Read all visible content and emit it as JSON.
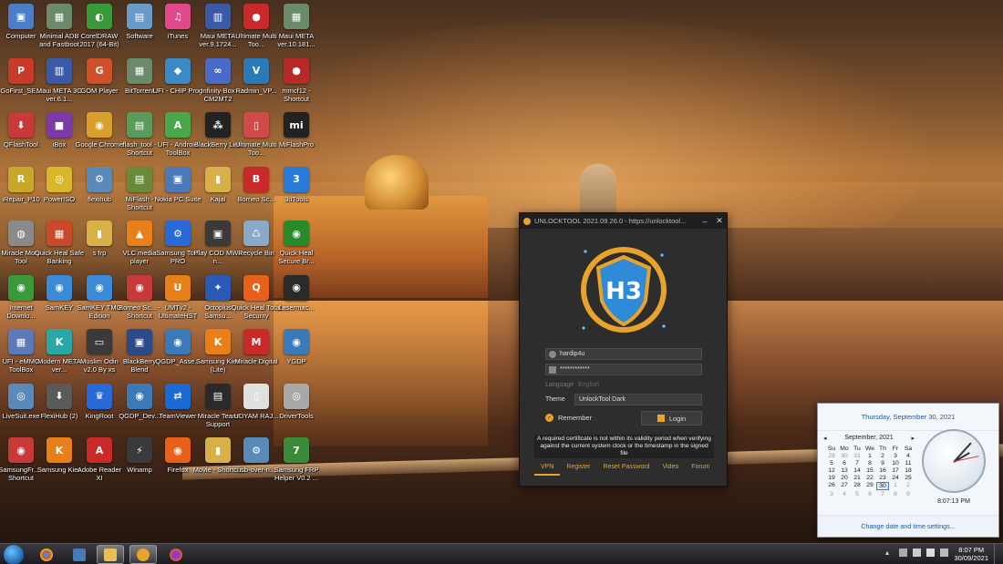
{
  "desktop_icons": [
    {
      "label": "Computer",
      "glyph": "▣",
      "color": "#4a7fc8"
    },
    {
      "label": "Minimal ADB and Fastboot",
      "glyph": "▦",
      "color": "#6a8a6a"
    },
    {
      "label": "CorelDRAW 2017 (64-Bit)",
      "glyph": "◐",
      "color": "#3a9a3a"
    },
    {
      "label": "Software",
      "glyph": "▤",
      "color": "#6a9ac8"
    },
    {
      "label": "iTunes",
      "glyph": "♫",
      "color": "#e04a8a"
    },
    {
      "label": "Maui META ver.9.1724...",
      "glyph": "▥",
      "color": "#3a5aa8"
    },
    {
      "label": "Ultimate Multi Too...",
      "glyph": "●",
      "color": "#c82a2a"
    },
    {
      "label": "Maui META ver.10.181...",
      "glyph": "▦",
      "color": "#6a8a6a"
    },
    {
      "label": "GoFirst_SE...",
      "glyph": "P",
      "color": "#c83a2a"
    },
    {
      "label": "Maui META 3G ver.6.1...",
      "glyph": "▥",
      "color": "#3a5aa8"
    },
    {
      "label": "GOM Player",
      "glyph": "G",
      "color": "#d0502a"
    },
    {
      "label": "BitTorrent",
      "glyph": "▦",
      "color": "#6a8a6a"
    },
    {
      "label": "UFI - CHIP Prog",
      "glyph": "◆",
      "color": "#3a8ac8"
    },
    {
      "label": "Infinity-Box CM2MT2",
      "glyph": "∞",
      "color": "#4a6ac8"
    },
    {
      "label": "Radmin_VP...",
      "glyph": "V",
      "color": "#2a7ab8"
    },
    {
      "label": "mmcf12 - Shortcut",
      "glyph": "●",
      "color": "#b82a2a"
    },
    {
      "label": "QFlashTool",
      "glyph": "⬇",
      "color": "#c83a3a"
    },
    {
      "label": "iBox",
      "glyph": "■",
      "color": "#7a3aa8"
    },
    {
      "label": "Google Chrome",
      "glyph": "◉",
      "color": "#d8a02a"
    },
    {
      "label": "flash_tool - Shortcut",
      "glyph": "▤",
      "color": "#5a9a5a"
    },
    {
      "label": "UFI - Android ToolBox",
      "glyph": "A",
      "color": "#4aa84a"
    },
    {
      "label": "BlackBerry Link",
      "glyph": "⁂",
      "color": "#222222"
    },
    {
      "label": "Ultimate Multi Too...",
      "glyph": "▯",
      "color": "#d04a4a"
    },
    {
      "label": "MiFlashPro",
      "glyph": "mi",
      "color": "#222222"
    },
    {
      "label": "iRepair_P10",
      "glyph": "R",
      "color": "#c8a82a"
    },
    {
      "label": "PowerISO",
      "glyph": "◎",
      "color": "#d8b82a"
    },
    {
      "label": "flexihub",
      "glyph": "⚙",
      "color": "#5a8ab8"
    },
    {
      "label": "MiFlash - Shortcut",
      "glyph": "▤",
      "color": "#6a8a3a"
    },
    {
      "label": "Nokia PC Suite",
      "glyph": "▣",
      "color": "#4a7ab8"
    },
    {
      "label": "Kajal",
      "glyph": "▮",
      "color": "#d8b04a"
    },
    {
      "label": "Borneo Sc...",
      "glyph": "B",
      "color": "#c82a2a"
    },
    {
      "label": "3uTools",
      "glyph": "3",
      "color": "#2a7ad8"
    },
    {
      "label": "Miracle Moto Tool",
      "glyph": "◍",
      "color": "#8a8a8a"
    },
    {
      "label": "Quick Heal Safe Banking",
      "glyph": "▦",
      "color": "#c84a2a"
    },
    {
      "label": "s frp",
      "glyph": "▮",
      "color": "#d8b04a"
    },
    {
      "label": "VLC media player",
      "glyph": "▲",
      "color": "#e8801a"
    },
    {
      "label": "Samsung Tool PRO",
      "glyph": "⚙",
      "color": "#2a6ad8"
    },
    {
      "label": "Play COD MW3 n...",
      "glyph": "▣",
      "color": "#3a3a3a"
    },
    {
      "label": "Recycle Bin",
      "glyph": "♺",
      "color": "#8aa8c8"
    },
    {
      "label": "Quick Heal Secure Br...",
      "glyph": "◉",
      "color": "#2a8a2a"
    },
    {
      "label": "Internet Downlo...",
      "glyph": "◉",
      "color": "#3a9a3a"
    },
    {
      "label": "SamKEY",
      "glyph": "◉",
      "color": "#3a8ad8"
    },
    {
      "label": "SamKEY TMO Edition",
      "glyph": "◉",
      "color": "#3a8ad8"
    },
    {
      "label": "Borneo Sc... - Shortcut",
      "glyph": "◉",
      "color": "#c83a3a"
    },
    {
      "label": "UMTv2 - UltimateHST",
      "glyph": "U",
      "color": "#e8801a"
    },
    {
      "label": "Octoplus Samsu...",
      "glyph": "✦",
      "color": "#2a5ab8"
    },
    {
      "label": "Quick Heal Total Security",
      "glyph": "Q",
      "color": "#e8601a"
    },
    {
      "label": "Lasermac...",
      "glyph": "◉",
      "color": "#2a2a2a"
    },
    {
      "label": "UFI - eMMC ToolBox",
      "glyph": "▦",
      "color": "#5a7ab8"
    },
    {
      "label": "Modern META ver...",
      "glyph": "K",
      "color": "#2aa8a8"
    },
    {
      "label": "Muslim Odin v2.0 By xs",
      "glyph": "▭",
      "color": "#3a3a3a"
    },
    {
      "label": "BlackBerry Blend",
      "glyph": "▣",
      "color": "#2a4a8a"
    },
    {
      "label": "QGDP_Asse...",
      "glyph": "◉",
      "color": "#3a7ab8"
    },
    {
      "label": "Samsung Kies (Lite)",
      "glyph": "K",
      "color": "#e8801a"
    },
    {
      "label": "Miracle Digital",
      "glyph": "M",
      "color": "#c82a2a"
    },
    {
      "label": "YGDP",
      "glyph": "◉",
      "color": "#3a7ab8"
    },
    {
      "label": "LiveSuit.exe",
      "glyph": "◎",
      "color": "#5a8ab8"
    },
    {
      "label": "FlexiHub (2)",
      "glyph": "⬇",
      "color": "#5a5a5a"
    },
    {
      "label": "KingRoot",
      "glyph": "♛",
      "color": "#2a6ad8"
    },
    {
      "label": "QGDP_Dev...",
      "glyph": "◉",
      "color": "#3a7ab8"
    },
    {
      "label": "TeamViewer",
      "glyph": "⇄",
      "color": "#1a6ad8"
    },
    {
      "label": "Miracle Team Support",
      "glyph": "▤",
      "color": "#2a2a2a"
    },
    {
      "label": "UDYAM RAJ...",
      "glyph": "▯",
      "color": "#e0e0e0"
    },
    {
      "label": "DriverTools",
      "glyph": "◎",
      "color": "#a8a8a8"
    },
    {
      "label": "SamsungFr... - Shortcut",
      "glyph": "◉",
      "color": "#c83a3a"
    },
    {
      "label": "Samsung Kies",
      "glyph": "K",
      "color": "#e8801a"
    },
    {
      "label": "Adobe Reader XI",
      "glyph": "A",
      "color": "#c82a2a"
    },
    {
      "label": "Winamp",
      "glyph": "⚡",
      "color": "#3a3a3a"
    },
    {
      "label": "Firefox",
      "glyph": "◉",
      "color": "#e8601a"
    },
    {
      "label": "Movie - Shortcut",
      "glyph": "▮",
      "color": "#d8b04a"
    },
    {
      "label": "usb-over-n...",
      "glyph": "⚙",
      "color": "#5a8ab8"
    },
    {
      "label": "Samsung FRP Helper V0.2 ...",
      "glyph": "7",
      "color": "#3a8a3a"
    }
  ],
  "unlocktool": {
    "title": "UNLOCKTOOL 2021.09.26.0 - https://unlocktool...",
    "username": "hardip4u",
    "password": "************",
    "language_label": "Language",
    "language_value": "English",
    "theme_label": "Theme",
    "theme_value": "UnlockTool Dark",
    "remember_label": "Remember",
    "login_label": "Login",
    "message": "A required certificate is not within its validity period when verifying against the current system clock or the timestamp in the signed file",
    "tabs": [
      "VPN",
      "Register",
      "Reset Password",
      "Video",
      "Forum"
    ],
    "accent": "#e8a32a"
  },
  "calendar": {
    "header": "Thursday, September 30, 2021",
    "month": "September, 2021",
    "weekdays": [
      "Su",
      "Mo",
      "Tu",
      "We",
      "Th",
      "Fr",
      "Sa"
    ],
    "days": [
      [
        "29",
        "30",
        "31",
        "1",
        "2",
        "3",
        "4"
      ],
      [
        "5",
        "6",
        "7",
        "8",
        "9",
        "10",
        "11"
      ],
      [
        "12",
        "13",
        "14",
        "15",
        "16",
        "17",
        "18"
      ],
      [
        "19",
        "20",
        "21",
        "22",
        "23",
        "24",
        "25"
      ],
      [
        "26",
        "27",
        "28",
        "29",
        "30",
        "1",
        "2"
      ],
      [
        "3",
        "4",
        "5",
        "6",
        "7",
        "8",
        "9"
      ]
    ],
    "today": "30",
    "time": "8:07:13 PM",
    "footer_link": "Change date and time settings..."
  },
  "taskbar": {
    "clock_time": "8:07 PM",
    "clock_date": "30/09/2021"
  }
}
